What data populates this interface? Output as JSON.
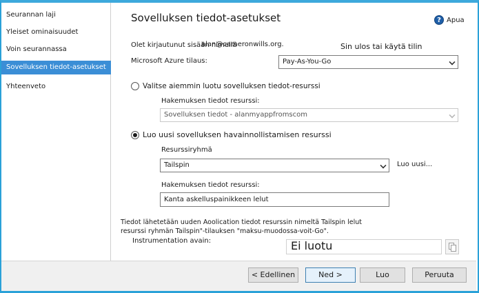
{
  "sidebar": {
    "items": [
      {
        "label": "Seurannan laji",
        "active": false
      },
      {
        "label": "Yleiset ominaisuudet",
        "active": false
      },
      {
        "label": "Voin seurannassa",
        "active": false
      },
      {
        "label": "Sovelluksen tiedot-asetukset",
        "active": true
      },
      {
        "label": "Yhteenveto",
        "active": false
      }
    ]
  },
  "header": {
    "title": "Sovelluksen tiedot-asetukset",
    "help_label": "Apua"
  },
  "account": {
    "signed_in_text": "Olet kirjautunut sisään nimellä",
    "email": "alan@cameronwills.org.",
    "signout_link": "Sin ulos tai käytä tilin",
    "subscription_label": "Microsoft Azure tilaus:",
    "subscription_value": "Pay-As-You-Go"
  },
  "existing": {
    "radio_label": "Valitse aiemmin luotu sovelluksen tiedot-resurssi",
    "resource_label": "Hakemuksen tiedot resurssi:",
    "resource_value": "Sovelluksen tiedot - alanmyappfromscom"
  },
  "create_new": {
    "radio_label": "Luo uusi sovelluksen havainnollistamisen resurssi",
    "group_label": "Resurssiryhmä",
    "group_value": "Tailspin",
    "new_link": "Luo uusi...",
    "resource_label": "Hakemuksen tiedot resurssi:",
    "resource_value": "Kanta askelluspainikkeen lelut"
  },
  "info": {
    "line1": "Tiedot lähetetään uuden Aoolication tiedot resurssin nimeltä Tailspin lelut",
    "line2": "resurssi ryhmän Tailspin\"-tilauksen \"maksu-muodossa-voit-Go\".",
    "ikey_label": "Instrumentation avain:",
    "ikey_value": "Ei luotu"
  },
  "footer": {
    "prev": "< Edellinen",
    "next": "Ned >",
    "create": "Luo",
    "cancel": "Peruuta"
  }
}
